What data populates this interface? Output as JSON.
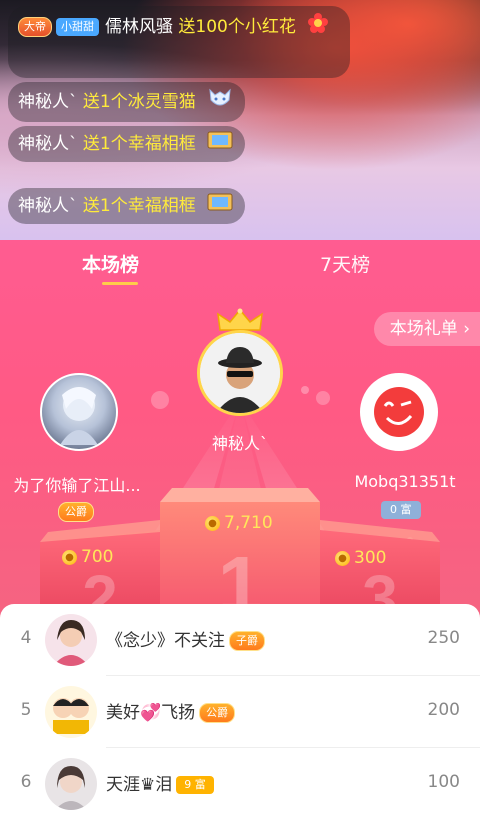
{
  "chat": {
    "top": {
      "badge_level": "大帝",
      "badge_fan": "小甜甜",
      "user": "儒林风骚",
      "gift_text": "送100个小红花"
    },
    "messages": [
      {
        "user": "神秘人`",
        "gift_text": "送1个冰灵雪猫",
        "icon": "ice-cat-icon"
      },
      {
        "user": "神秘人`",
        "gift_text": "送1个幸福相框",
        "icon": "photo-frame-icon"
      },
      {
        "user": "神秘人`",
        "gift_text": "送1个幸福相框",
        "icon": "photo-frame-icon"
      }
    ]
  },
  "ranking": {
    "tabs": [
      {
        "label": "本场榜",
        "active": true
      },
      {
        "label": "7天榜",
        "active": false
      }
    ],
    "gift_list_button": "本场礼单 ›",
    "podium": {
      "first": {
        "name": "神秘人`",
        "score": "7,710",
        "place": "1"
      },
      "second": {
        "name": "为了你输了江山...",
        "badge": "公爵",
        "score": "700",
        "place": "2"
      },
      "third": {
        "name": "Mobq31351t",
        "badge": "0 富",
        "score": "300",
        "place": "3"
      }
    },
    "list": [
      {
        "rank": "4",
        "name": "《念少》不关注",
        "badge": "子爵",
        "value": "250"
      },
      {
        "rank": "5",
        "name": "美好💞飞扬",
        "badge": "公爵",
        "value": "200"
      },
      {
        "rank": "6",
        "name": "天涯♛泪",
        "badge": "9 富",
        "value": "100"
      }
    ]
  },
  "colors": {
    "panel_pink": "#ff5a84",
    "score_yellow": "#ffe75a",
    "crown_gold": "#ffd54a"
  }
}
